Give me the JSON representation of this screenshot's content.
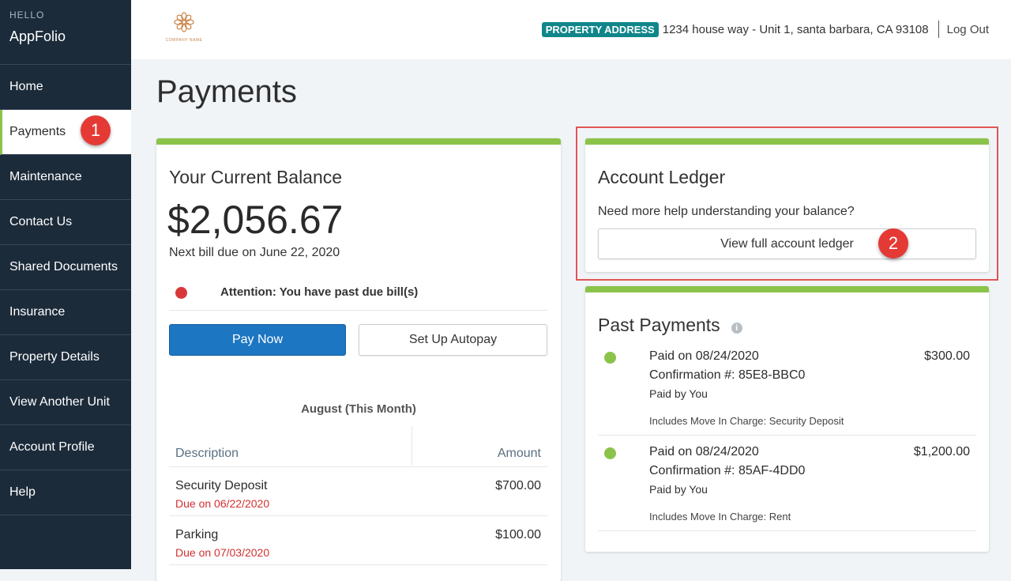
{
  "sidebar": {
    "hello": "HELLO",
    "app_name": "AppFolio",
    "items": [
      {
        "label": "Home"
      },
      {
        "label": "Payments"
      },
      {
        "label": "Maintenance"
      },
      {
        "label": "Contact Us"
      },
      {
        "label": "Shared Documents"
      },
      {
        "label": "Insurance"
      },
      {
        "label": "Property Details"
      },
      {
        "label": "View Another Unit"
      },
      {
        "label": "Account Profile"
      },
      {
        "label": "Help"
      }
    ]
  },
  "header": {
    "logo_text": "COMPANY NAME",
    "property_tag": "PROPERTY ADDRESS",
    "property_address": "1234 house way - Unit 1, santa barbara, CA 93108",
    "logout_label": "Log Out"
  },
  "page": {
    "title": "Payments"
  },
  "balance": {
    "title": "Your Current Balance",
    "amount": "$2,056.67",
    "next_bill": "Next bill due on June 22, 2020",
    "attention": "Attention: You have past due bill(s)",
    "pay_now_label": "Pay Now",
    "autopay_label": "Set Up Autopay",
    "period_label": "August (This Month)",
    "table": {
      "col_description": "Description",
      "col_amount": "Amount",
      "rows": [
        {
          "description": "Security Deposit",
          "due": "Due on 06/22/2020",
          "amount": "$700.00"
        },
        {
          "description": "Parking",
          "due": "Due on 07/03/2020",
          "amount": "$100.00"
        }
      ]
    }
  },
  "ledger": {
    "title": "Account Ledger",
    "help_text": "Need more help understanding your balance?",
    "button_label": "View full account ledger"
  },
  "past_payments": {
    "title": "Past Payments",
    "info_glyph": "i",
    "items": [
      {
        "paid_on": "Paid on 08/24/2020",
        "confirmation": "Confirmation #: 85E8-BBC0",
        "paid_by": "Paid by You",
        "includes": "Includes Move In Charge: Security Deposit",
        "amount": "$300.00"
      },
      {
        "paid_on": "Paid on 08/24/2020",
        "confirmation": "Confirmation #: 85AF-4DD0",
        "paid_by": "Paid by You",
        "includes": "Includes Move In Charge: Rent",
        "amount": "$1,200.00"
      }
    ]
  },
  "annotations": {
    "badge_1": "1",
    "badge_2": "2"
  },
  "colors": {
    "accent_green": "#8bc34a",
    "primary_blue": "#1d76c2",
    "sidebar_bg": "#1c2b3a",
    "alert_red": "#d32f2f",
    "tag_teal": "#10868a"
  }
}
